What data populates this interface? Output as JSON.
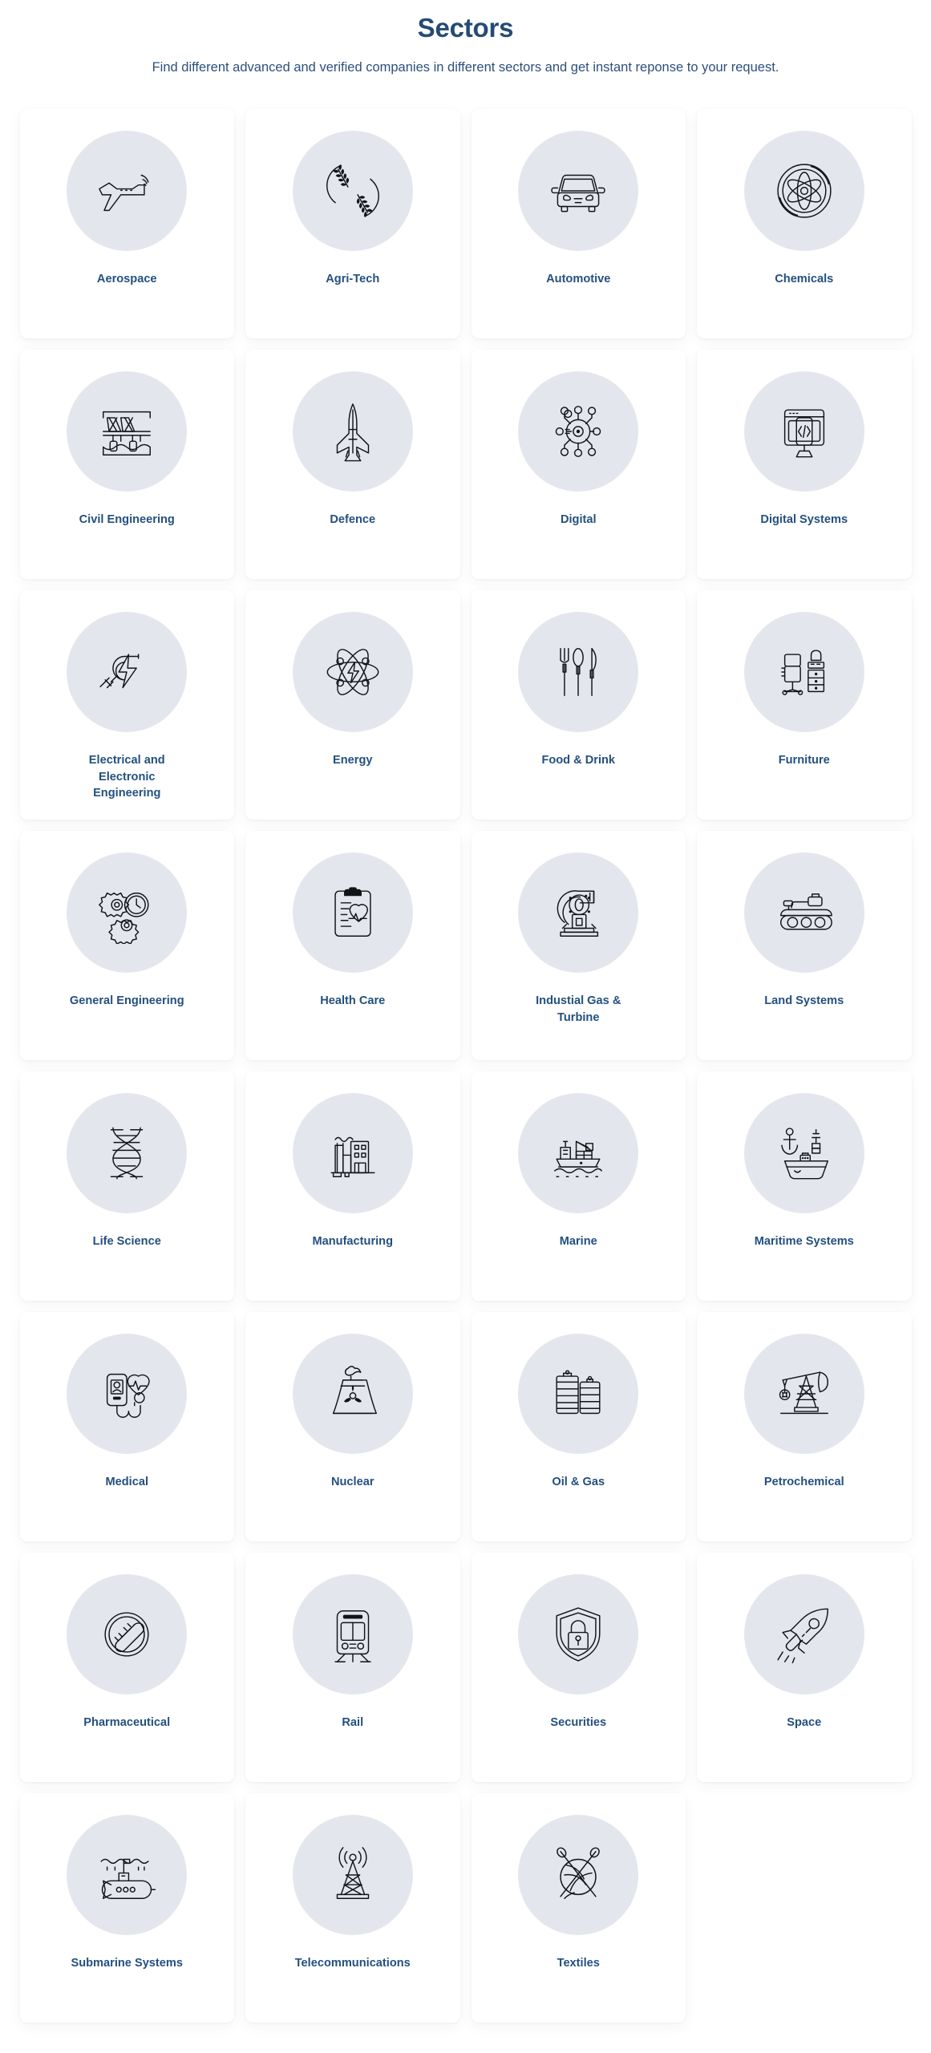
{
  "header": {
    "title": "Sectors",
    "subtitle": "Find different advanced and verified companies in different sectors and get instant reponse to your request."
  },
  "colors": {
    "page_background": "#ffffff",
    "card_background": "#ffffff",
    "icon_badge_background": "#e3e7ed",
    "title_color": "#254a77",
    "label_color": "#24507f",
    "icon_stroke": "#121417"
  },
  "grid": {
    "columns": 4,
    "rows": 8,
    "total_cards": 31
  },
  "sectors": [
    {
      "label": "Aerospace",
      "icon": "airplane-icon"
    },
    {
      "label": "Agri-Tech",
      "icon": "wheat-wreath-icon"
    },
    {
      "label": "Automotive",
      "icon": "car-front-icon"
    },
    {
      "label": "Chemicals",
      "icon": "atom-circle-icon"
    },
    {
      "label": "Civil Engineering",
      "icon": "bridge-icon"
    },
    {
      "label": "Defence",
      "icon": "fighter-jet-icon"
    },
    {
      "label": "Digital",
      "icon": "network-node-icon"
    },
    {
      "label": "Digital Systems",
      "icon": "monitor-code-icon"
    },
    {
      "label": "Electrical and Electronic Engineering",
      "icon": "plug-bolt-icon"
    },
    {
      "label": "Energy",
      "icon": "atom-bolt-icon"
    },
    {
      "label": "Food & Drink",
      "icon": "cutlery-icon"
    },
    {
      "label": "Furniture",
      "icon": "office-furniture-icon"
    },
    {
      "label": "General Engineering",
      "icon": "gears-clock-icon"
    },
    {
      "label": "Health Care",
      "icon": "clipboard-heartbeat-icon"
    },
    {
      "label": "Industial Gas & Turbine",
      "icon": "turbine-icon"
    },
    {
      "label": "Land Systems",
      "icon": "tank-icon"
    },
    {
      "label": "Life Science",
      "icon": "dna-icon"
    },
    {
      "label": "Manufacturing",
      "icon": "factory-icon"
    },
    {
      "label": "Marine",
      "icon": "cargo-ship-icon"
    },
    {
      "label": "Maritime Systems",
      "icon": "anchor-ship-icon"
    },
    {
      "label": "Medical",
      "icon": "medical-monitor-icon"
    },
    {
      "label": "Nuclear",
      "icon": "cooling-tower-icon"
    },
    {
      "label": "Oil & Gas",
      "icon": "oil-barrels-icon"
    },
    {
      "label": "Petrochemical",
      "icon": "pumpjack-icon"
    },
    {
      "label": "Pharmaceutical",
      "icon": "pill-capsule-icon"
    },
    {
      "label": "Rail",
      "icon": "train-icon"
    },
    {
      "label": "Securities",
      "icon": "shield-lock-icon"
    },
    {
      "label": "Space",
      "icon": "rocket-icon"
    },
    {
      "label": "Submarine Systems",
      "icon": "submarine-icon"
    },
    {
      "label": "Telecommunications",
      "icon": "radio-tower-icon"
    },
    {
      "label": "Textiles",
      "icon": "yarn-needles-icon"
    }
  ]
}
